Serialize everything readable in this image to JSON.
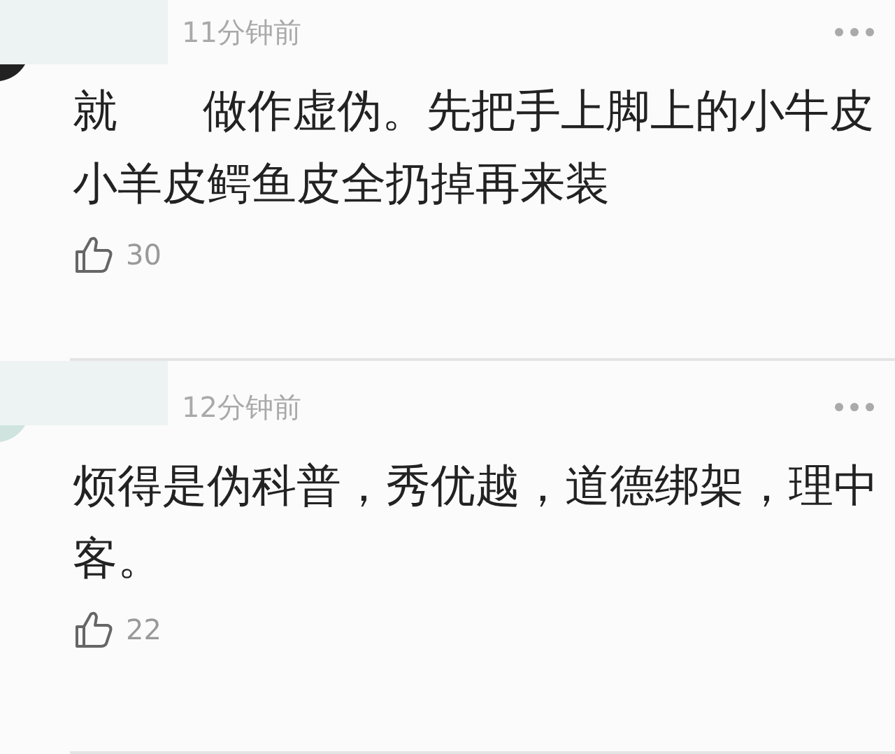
{
  "comments": [
    {
      "time": "11分钟前",
      "text_parts": [
        "就",
        "做作虚伪。先把手上脚上的小牛皮小羊皮鳄鱼皮全扔掉再来装"
      ],
      "likes": "30"
    },
    {
      "time": "12分钟前",
      "text_parts": [
        "烦得是伪科普，秀优越，道德绑架，理中客。"
      ],
      "likes": "22"
    }
  ]
}
